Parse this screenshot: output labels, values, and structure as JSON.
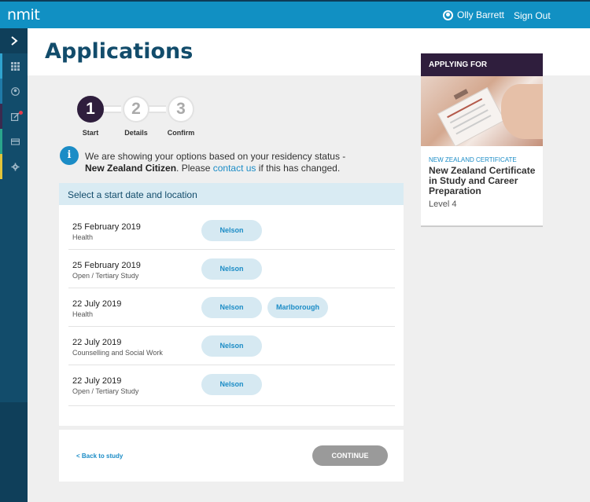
{
  "app": {
    "logo": "nmit"
  },
  "header": {
    "user_name": "Olly Barrett",
    "sign_out": "Sign Out"
  },
  "sidebar": {
    "items": [
      {
        "icon": "grid-icon",
        "accent": "#2fa3cf"
      },
      {
        "icon": "user-icon",
        "accent": "#1f7aa8"
      },
      {
        "icon": "edit-icon",
        "accent": "#3b2a4f",
        "notification": true
      },
      {
        "icon": "card-icon",
        "accent": "#2aa58b"
      },
      {
        "icon": "gear-icon",
        "accent": "#e3c43a"
      }
    ]
  },
  "page": {
    "title": "Applications"
  },
  "steps": [
    {
      "number": "1",
      "label": "Start",
      "active": true
    },
    {
      "number": "2",
      "label": "Details",
      "active": false
    },
    {
      "number": "3",
      "label": "Confirm",
      "active": false
    }
  ],
  "info": {
    "icon_glyph": "i",
    "text_before": "We are showing your options based on your residency status -",
    "status": "New Zealand Citizen",
    "text_mid": ". Please ",
    "link": "contact us",
    "text_after": " if this has changed."
  },
  "panel": {
    "heading": "Select a start date and location",
    "rows": [
      {
        "date": "25 February 2019",
        "area": "Health",
        "locations": [
          "Nelson"
        ]
      },
      {
        "date": "25 February 2019",
        "area": "Open / Tertiary Study",
        "locations": [
          "Nelson"
        ]
      },
      {
        "date": "22 July 2019",
        "area": "Health",
        "locations": [
          "Nelson",
          "Marlborough"
        ]
      },
      {
        "date": "22 July 2019",
        "area": "Counselling and Social Work",
        "locations": [
          "Nelson"
        ]
      },
      {
        "date": "22 July 2019",
        "area": "Open / Tertiary Study",
        "locations": [
          "Nelson"
        ]
      }
    ]
  },
  "footer": {
    "back_label": "< Back to study",
    "continue_label": "CONTINUE"
  },
  "applying": {
    "heading": "APPLYING FOR",
    "type": "NEW ZEALAND CERTIFICATE",
    "title": "New Zealand Certificate in Study and Career Preparation",
    "level": "Level 4"
  },
  "colors": {
    "primary": "#1190c3",
    "navy": "#124c6b",
    "purple": "#2f1e3d",
    "pill": "#d6e9f2"
  }
}
